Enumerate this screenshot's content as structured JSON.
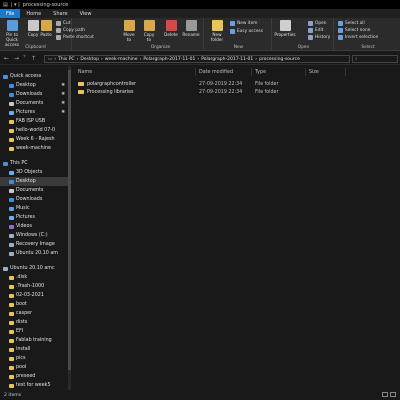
{
  "window": {
    "title": "processing-source"
  },
  "tabs": [
    "File",
    "Home",
    "Share",
    "View"
  ],
  "ribbon": {
    "clipboard": {
      "label": "Clipboard",
      "pin": "Pin to Quick\naccess",
      "copy": "Copy",
      "paste": "Paste",
      "cut": "Cut",
      "copy_path": "Copy path",
      "paste_shortcut": "Paste shortcut"
    },
    "organize": {
      "label": "Organize",
      "move_to": "Move\nto",
      "copy_to": "Copy\nto"
    },
    "delete": "Delete",
    "rename": "Rename",
    "new": {
      "label": "New",
      "new_folder": "New\nfolder",
      "new_item": "New item",
      "easy_access": "Easy access"
    },
    "open": {
      "label": "Open",
      "properties": "Properties",
      "open": "Open",
      "edit": "Edit",
      "history": "History"
    },
    "select": {
      "label": "Select",
      "select_all": "Select all",
      "select_none": "Select none",
      "invert": "Invert selection"
    }
  },
  "address": {
    "crumbs": [
      "This PC",
      "Desktop",
      "week-machine",
      "Polargraph-2017-11-01",
      "Polargraph-2017-11-01",
      "processing-source"
    ]
  },
  "nav": {
    "quick_access": "Quick access",
    "items": [
      "Desktop",
      "Downloads",
      "Documents",
      "Pictures",
      "FAB ISP USB",
      "hello-world 07-0",
      "Week 6 - Rajesh",
      "week-machine"
    ],
    "this_pc": "This PC",
    "pc_items": [
      "3D Objects",
      "Desktop",
      "Documents",
      "Downloads",
      "Music",
      "Pictures",
      "Videos",
      "Windows (C:)",
      "Recovery Image",
      "Ubuntu 20.10 am"
    ],
    "usb": "Ubuntu 20.10 amc",
    "usb_items": [
      ".disk",
      ".Trash-1000",
      "02-03-2021",
      "boot",
      "casper",
      "dists",
      "EFI",
      "Fablab training",
      "install",
      "pics",
      "pool",
      "preseed",
      "test for week5"
    ]
  },
  "columns": {
    "name": "Name",
    "date": "Date modified",
    "type": "Type",
    "size": "Size"
  },
  "files": [
    {
      "name": "polargraphcontroller",
      "date": "27-09-2019 22:34",
      "type": "File folder",
      "size": ""
    },
    {
      "name": "Processing libraries",
      "date": "27-09-2019 22:34",
      "type": "File folder",
      "size": ""
    }
  ],
  "status": {
    "count": "2 items"
  },
  "colors": {
    "accent": "#1979ca",
    "folder": "#e8c45c",
    "bg": "#191919"
  }
}
